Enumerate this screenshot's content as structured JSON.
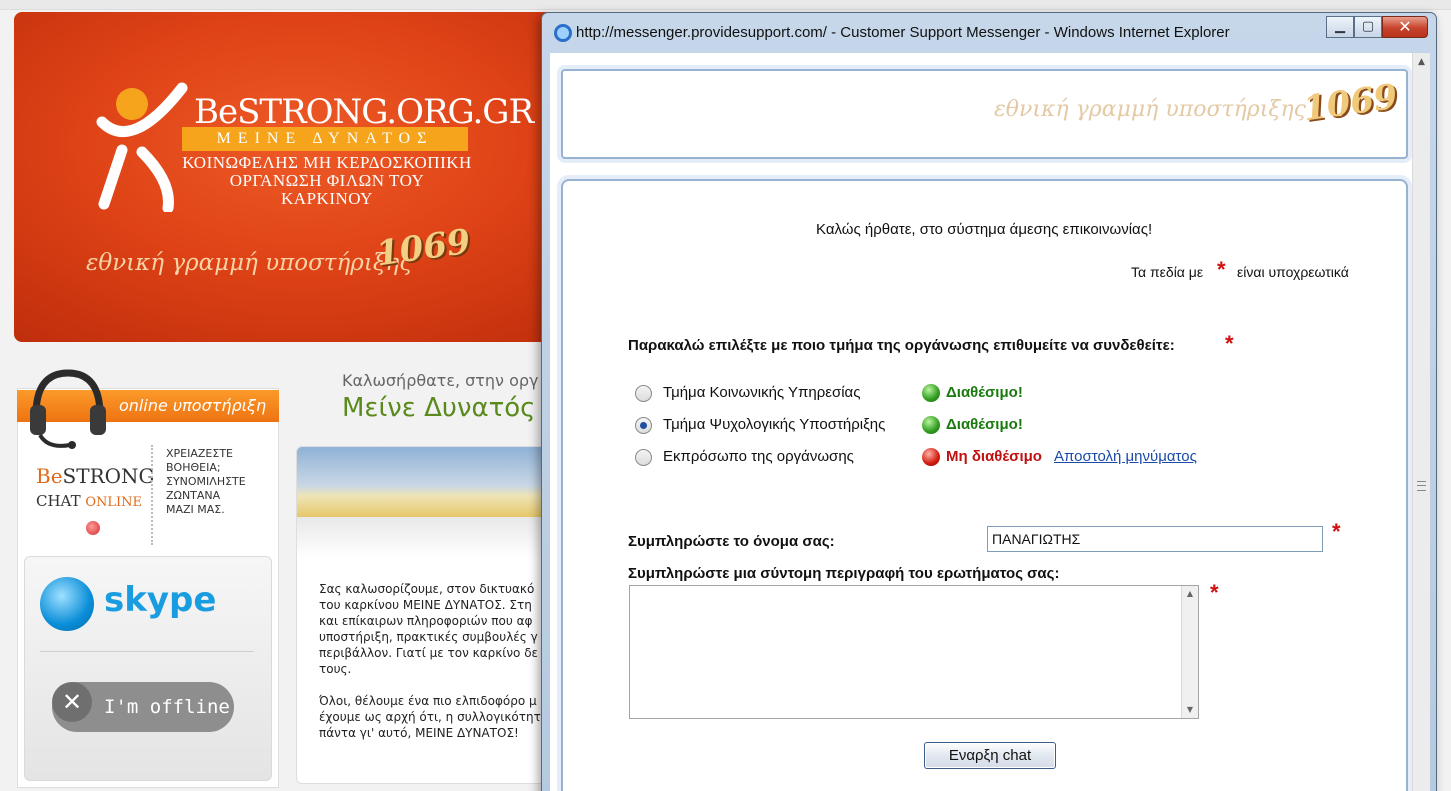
{
  "background_page": {
    "banner": {
      "logo_be": "Be",
      "logo_strong": "STRONG",
      "logo_domain": ".ORG.GR",
      "logo_motto": "ΜΕΙΝΕ ΔΥΝΑΤΟΣ",
      "logo_sub1": "ΚΟΙΝΩΦΕΛΗΣ ΜΗ ΚΕΡΔΟΣΚΟΠΙΚΗ",
      "logo_sub2": "ΟΡΓΑΝΩΣΗ ΦΙΛΩΝ ΤΟΥ ΚΑΡΚΙΝΟΥ",
      "slogan": "εθνική γραμμή υποστήριξης",
      "hotline": "1069"
    },
    "online_support": {
      "tab_label": "online υποστήριξη",
      "chat_logo_be": "Be",
      "chat_logo_strong": "STRONG",
      "chat_logo_chat": "CHAT",
      "chat_logo_online": "ONLINE",
      "help_line1": "ΧΡΕΙΑΖΕΣΤΕ",
      "help_line2": "ΒΟΗΘΕΙΑ;",
      "help_line3": "ΣΥΝΟΜΙΛΗΣΤΕ",
      "help_line4": "ΖΩΝΤΑΝΑ",
      "help_line5": "ΜΑΖΙ ΜΑΣ.",
      "skype_label": "skype",
      "offline_label": "I'm offline"
    },
    "welcome": {
      "small": "Καλωσήρθατε, στην οργ",
      "big": "Μείνε Δυνατός"
    },
    "body_paragraphs": [
      [
        "Σας καλωσορίζουμε, στον δικτυακό",
        "του καρκίνου ΜΕΙΝΕ ΔΥΝΑΤΟΣ. Στη",
        "και επίκαιρων πληροφοριών που αφ",
        "υποστήριξη, πρακτικές συμβουλές γ",
        "περιβάλλον. Γιατί με τον καρκίνο δε",
        "τους."
      ],
      [
        "Όλοι, θέλουμε ένα πιο ελπιδοφόρο μ",
        "έχουμε ως αρχή ότι, η συλλογικότητ",
        "πάντα γι' αυτό, ΜΕΙΝΕ ΔΥΝΑΤΟΣ!"
      ]
    ]
  },
  "ie_window": {
    "title": "http://messenger.providesupport.com/ - Customer Support Messenger - Windows Internet Explorer",
    "minimize_icon": "minimize-icon",
    "maximize_icon": "maximize-icon",
    "close_glyph": "✕",
    "header": {
      "slogan": "εθνική γραμμή υποστήριξης",
      "hotline": "1069"
    },
    "form": {
      "welcome": "Καλώς ήρθατε, στο σύστημα άμεσης επικοινωνίας!",
      "required_prefix": "Τα πεδία με",
      "required_star": "*",
      "required_suffix": "είναι υποχρεωτικά",
      "department_label": "Παρακαλώ επιλέξτε με ποιο τμήμα της οργάνωσης επιθυμείτε να συνδεθείτε:",
      "departments": [
        {
          "label": "Τμήμα Κοινωνικής Υπηρεσίας",
          "status": "Διαθέσιμο!",
          "available": true,
          "selected": false
        },
        {
          "label": "Τμήμα Ψυχολογικής Υποστήριξης",
          "status": "Διαθέσιμο!",
          "available": true,
          "selected": true
        },
        {
          "label": "Εκπρόσωπο της οργάνωσης",
          "status": "Μη διαθέσιμο",
          "available": false,
          "selected": false,
          "link": "Αποστολή μηνύματος"
        }
      ],
      "name_label": "Συμπληρώστε το όνομα σας:",
      "name_value": "ΠΑΝΑΓΙΩΤΗΣ",
      "description_label": "Συμπληρώστε μια σύντομη περιγραφή του ερωτήματος σας:",
      "description_value": "",
      "start_button": "Εναρξη chat"
    },
    "colors": {
      "available": "#1a7a10",
      "unavailable": "#c01010",
      "required": "#d01010",
      "link": "#1c4aa8"
    }
  }
}
